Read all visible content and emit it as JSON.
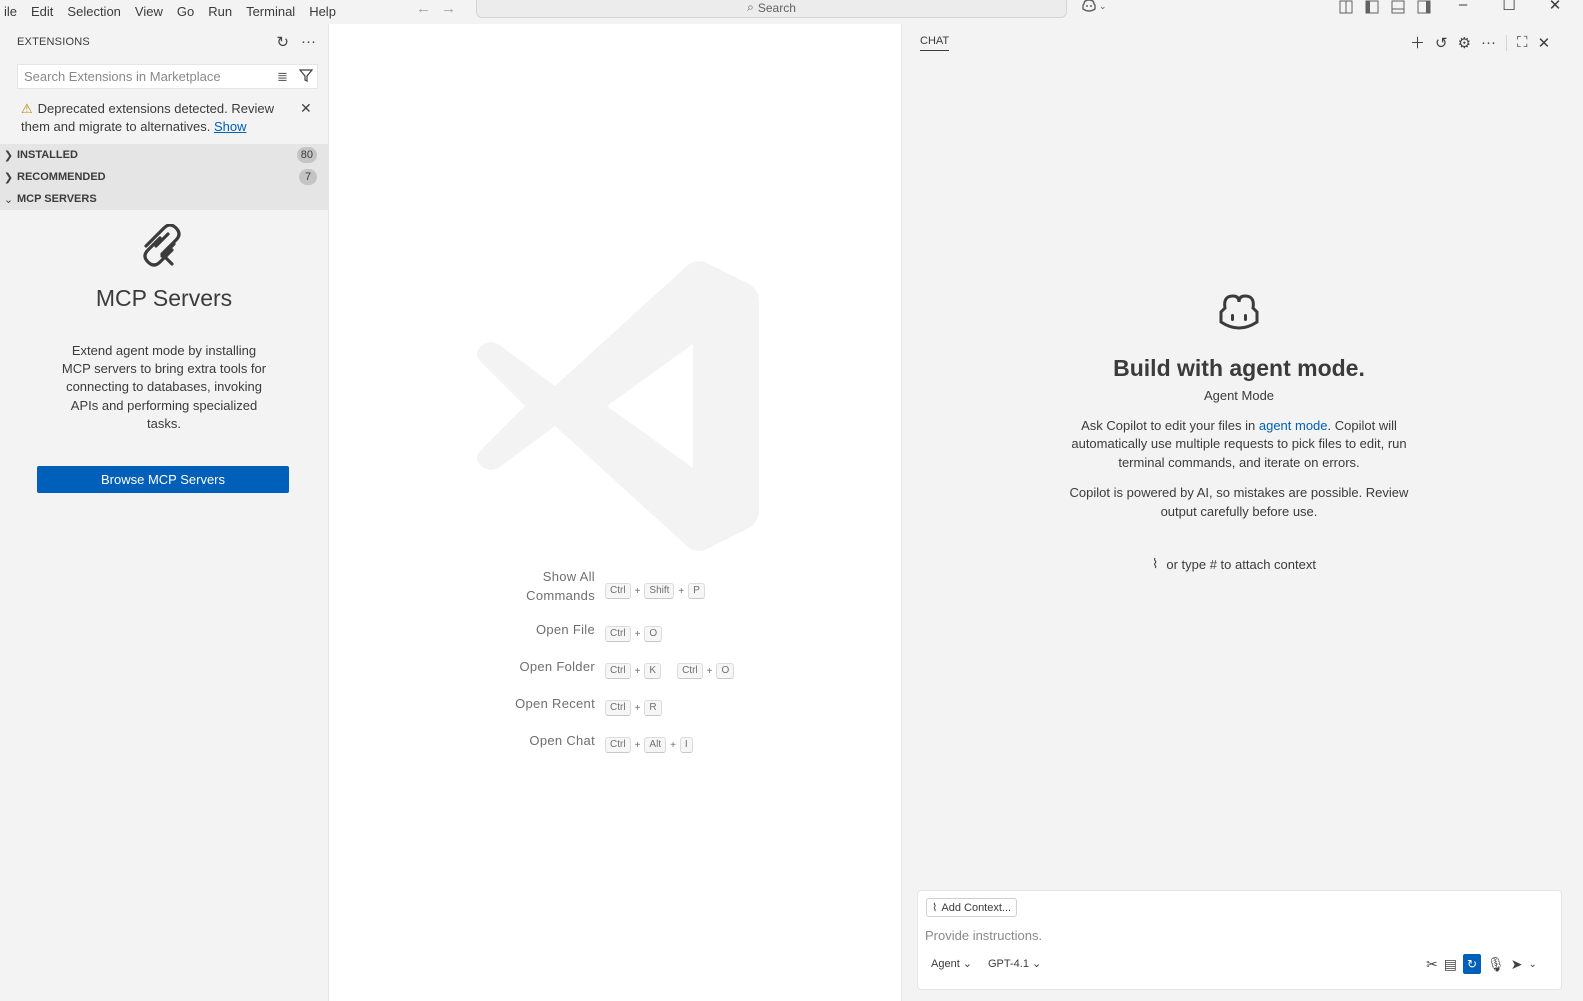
{
  "menu": [
    "ile",
    "Edit",
    "Selection",
    "View",
    "Go",
    "Run",
    "Terminal",
    "Help"
  ],
  "titlebar": {
    "search_label": "Search"
  },
  "sidebar": {
    "title": "EXTENSIONS",
    "search_placeholder": "Search Extensions in Marketplace",
    "warning_text": "Deprecated extensions detected. Review them and migrate to alternatives.",
    "warning_link": "Show",
    "sections": [
      {
        "label": "INSTALLED",
        "count": "80",
        "expanded": false
      },
      {
        "label": "RECOMMENDED",
        "count": "7",
        "expanded": false
      },
      {
        "label": "MCP SERVERS",
        "expanded": true
      }
    ],
    "mcp": {
      "title": "MCP Servers",
      "description": "Extend agent mode by installing MCP servers to bring extra tools for connecting to databases, invoking APIs and performing specialized tasks.",
      "button": "Browse MCP Servers"
    }
  },
  "editor": {
    "shortcuts": [
      {
        "label": "Show All Commands",
        "keys": [
          [
            "Ctrl",
            "Shift",
            "P"
          ]
        ]
      },
      {
        "label": "Open File",
        "keys": [
          [
            "Ctrl",
            "O"
          ]
        ]
      },
      {
        "label": "Open Folder",
        "keys": [
          [
            "Ctrl",
            "K"
          ],
          [
            "Ctrl",
            "O"
          ]
        ]
      },
      {
        "label": "Open Recent",
        "keys": [
          [
            "Ctrl",
            "R"
          ]
        ]
      },
      {
        "label": "Open Chat",
        "keys": [
          [
            "Ctrl",
            "Alt",
            "I"
          ]
        ]
      }
    ]
  },
  "chat": {
    "tab": "CHAT",
    "heading": "Build with agent mode.",
    "subheading": "Agent Mode",
    "para1_before": "Ask Copilot to edit your files in ",
    "para1_link": "agent mode",
    "para1_after": ". Copilot will automatically use multiple requests to pick files to edit, run terminal commands, and iterate on errors.",
    "para2": "Copilot is powered by AI, so mistakes are possible. Review output carefully before use.",
    "attach_hint": "or type # to attach context",
    "add_context": "Add Context...",
    "input_placeholder": "Provide instructions.",
    "mode": "Agent",
    "model": "GPT-4.1"
  },
  "colors": {
    "accent": "#005fb8",
    "sidebar_bg": "#f3f3f3",
    "section_bg": "#e5e5e5"
  }
}
